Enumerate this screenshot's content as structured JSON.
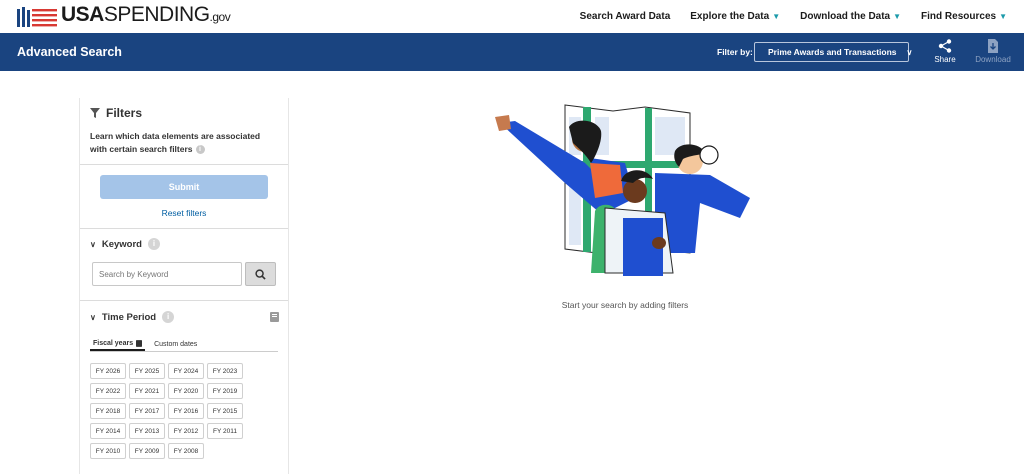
{
  "logo": {
    "usa": "USA",
    "spending": "SPENDING",
    "gov": ".gov"
  },
  "nav": {
    "items": [
      {
        "label": "Search Award Data",
        "dropdown": false
      },
      {
        "label": "Explore the Data",
        "dropdown": true
      },
      {
        "label": "Download the Data",
        "dropdown": true
      },
      {
        "label": "Find Resources",
        "dropdown": true
      }
    ]
  },
  "header": {
    "title": "Advanced Search",
    "filter_by_label": "Filter by:",
    "filter_select_value": "Prime Awards and Transactions",
    "share_label": "Share",
    "download_label": "Download"
  },
  "sidebar": {
    "title": "Filters",
    "description": "Learn which data elements are associated with certain search filters",
    "submit_label": "Submit",
    "reset_label": "Reset filters",
    "keyword": {
      "title": "Keyword",
      "placeholder": "Search by Keyword"
    },
    "time_period": {
      "title": "Time Period",
      "tabs": [
        {
          "label": "Fiscal years",
          "active": true
        },
        {
          "label": "Custom dates",
          "active": false
        }
      ],
      "fiscal_years": [
        "FY 2026",
        "FY 2025",
        "FY 2024",
        "FY 2023",
        "FY 2022",
        "FY 2021",
        "FY 2020",
        "FY 2019",
        "FY 2018",
        "FY 2017",
        "FY 2016",
        "FY 2015",
        "FY 2014",
        "FY 2013",
        "FY 2012",
        "FY 2011",
        "FY 2010",
        "FY 2009",
        "FY 2008"
      ]
    }
  },
  "main": {
    "hint": "Start your search by adding filters"
  },
  "colors": {
    "header_bg": "#1a4480",
    "submit_bg": "#a4c4e8",
    "link": "#005ea2",
    "nav_chevron": "#1b9aaa"
  }
}
